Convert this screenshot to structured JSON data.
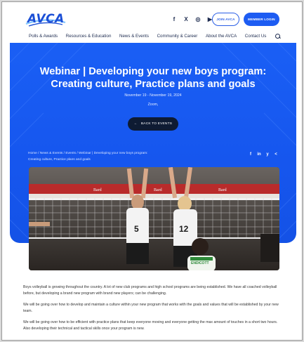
{
  "header": {
    "logo_text": "AVCA",
    "social": [
      {
        "icon": "facebook-icon",
        "glyph": "f"
      },
      {
        "icon": "x-icon",
        "glyph": "X"
      },
      {
        "icon": "instagram-icon",
        "glyph": "◎"
      },
      {
        "icon": "youtube-icon",
        "glyph": "▶"
      }
    ],
    "join_label": "JOIN AVCA",
    "login_label": "MEMBER LOGIN"
  },
  "nav": {
    "items": [
      "Polls & Awards",
      "Resources & Education",
      "News & Events",
      "Community & Career",
      "About the AVCA",
      "Contact Us"
    ]
  },
  "hero": {
    "title": "Webinar | Developing your new boys program: Creating culture, Practice plans and goals",
    "dates": "November 19 - November 19, 2024",
    "location": "Zoom,",
    "back_label": "BACK TO EVENTS",
    "breadcrumb": "Home / News & Events / Events / Webinar | Developing your new boys program: Creating culture, Practice plans and goals",
    "share": [
      {
        "icon": "facebook-icon",
        "glyph": "f"
      },
      {
        "icon": "linkedin-icon",
        "glyph": "in"
      },
      {
        "icon": "twitter-icon",
        "glyph": "y"
      },
      {
        "icon": "share-icon",
        "glyph": "<"
      }
    ]
  },
  "photo": {
    "banner_text": "Bard",
    "jersey_numbers": [
      "5",
      "12"
    ],
    "opponent_jersey": "ENDICOTT"
  },
  "body": {
    "paragraphs": [
      "Boys volleyball is growing throughout the country. A lot of new club programs and high school programs are being established. We have all coached volleyball before, but developing a brand new program with brand new players; can be challenging.",
      "We will be going over how to develop and maintain a culture within your new program that works with the goals and values that will be established by your new team.",
      "We will be going over how to be efficient with practice plans that keep everyone moving and everyone getting the max amount of touches in a short two hours. Also developing their technical and tactical skills once your program is new."
    ]
  },
  "colors": {
    "brand_blue": "#1d5cf2",
    "dark_navy": "#0e1b33"
  }
}
